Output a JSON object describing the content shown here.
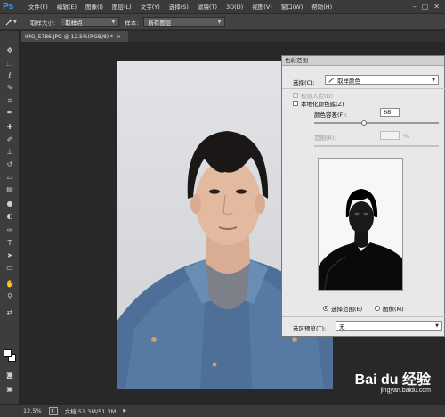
{
  "app": {
    "logo": "Ps"
  },
  "menu": {
    "items": [
      "文件(F)",
      "编辑(E)",
      "图像(I)",
      "图层(L)",
      "文字(Y)",
      "选择(S)",
      "滤镜(T)",
      "3D(D)",
      "视图(V)",
      "窗口(W)",
      "帮助(H)"
    ],
    "controls": [
      "–",
      "▢",
      "✕"
    ]
  },
  "options": {
    "sample_size_label": "取样大小:",
    "sample_size_value": "取样点",
    "sample_label": "样本:",
    "sample_value": "所有图层"
  },
  "document": {
    "tab_title": "IMG_5786.JPG @ 12.5%(RGB/8) *",
    "tab_close": "×"
  },
  "status": {
    "zoom": "12.5%",
    "doc_info": "文档:51.3M/51.3M"
  },
  "dialog": {
    "title": "色彩范围",
    "select_label": "选择(C):",
    "select_value": "取样颜色",
    "detect_faces_label": "检测人脸(D)",
    "localized_label": "本地化颜色簇(Z)",
    "fuzziness_label": "颜色容差(F):",
    "fuzziness_value": "68",
    "fuzziness_level": 0.4,
    "range_label": "范围(R):",
    "range_unit": "%",
    "radio_selection": "选择范围(E)",
    "radio_image": "图像(M)",
    "preview_label": "选区预览(T):",
    "preview_value": "无"
  },
  "watermark": {
    "main": "Bai du 经验",
    "sub": "jingyan.baidu.com"
  },
  "colors": {
    "foreground": "#ffffff",
    "background": "#ffffff",
    "accent": "#3fa0ff"
  },
  "icons": [
    "eyedropper-icon",
    "move-icon",
    "marquee-icon",
    "lasso-icon",
    "quick-select-icon",
    "crop-icon",
    "healing-icon",
    "brush-icon",
    "stamp-icon",
    "eraser-icon",
    "gradient-icon",
    "blur-icon",
    "dodge-icon",
    "pen-icon",
    "type-icon",
    "path-select-icon",
    "shape-icon",
    "hand-icon",
    "zoom-icon"
  ]
}
